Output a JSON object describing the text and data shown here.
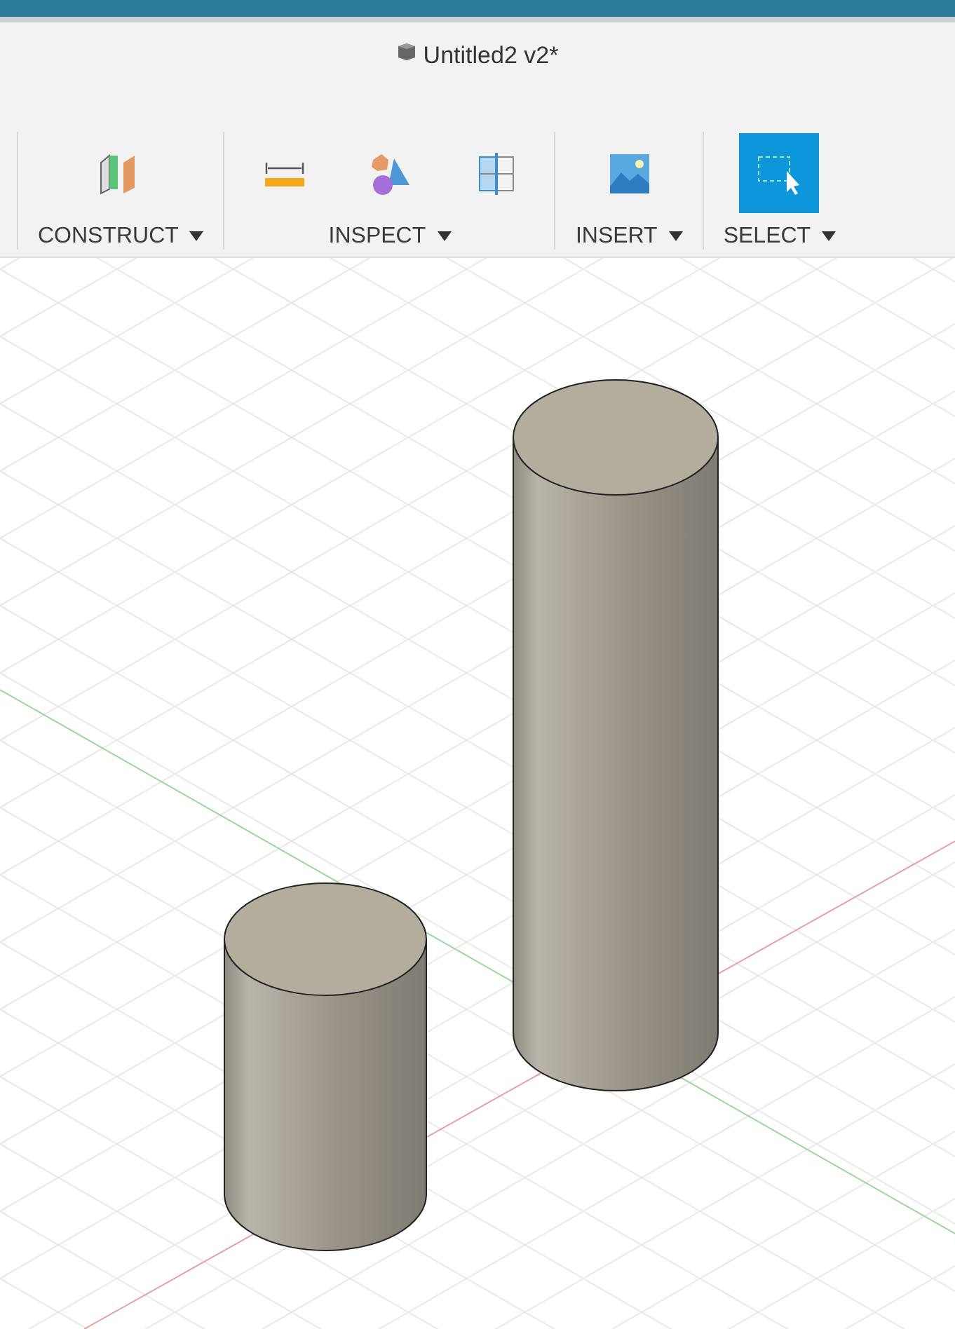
{
  "window": {
    "title": "Untitled2 v2*"
  },
  "toolbar": {
    "groups": [
      {
        "label": "CONSTRUCT",
        "tools": [
          {
            "kind": "planes",
            "selected": false
          }
        ]
      },
      {
        "label": "INSPECT",
        "tools": [
          {
            "kind": "measure",
            "selected": false
          },
          {
            "kind": "shapes",
            "selected": false
          },
          {
            "kind": "section",
            "selected": false
          }
        ]
      },
      {
        "label": "INSERT",
        "tools": [
          {
            "kind": "image",
            "selected": false
          }
        ]
      },
      {
        "label": "SELECT",
        "tools": [
          {
            "kind": "select",
            "selected": true
          }
        ]
      }
    ]
  }
}
